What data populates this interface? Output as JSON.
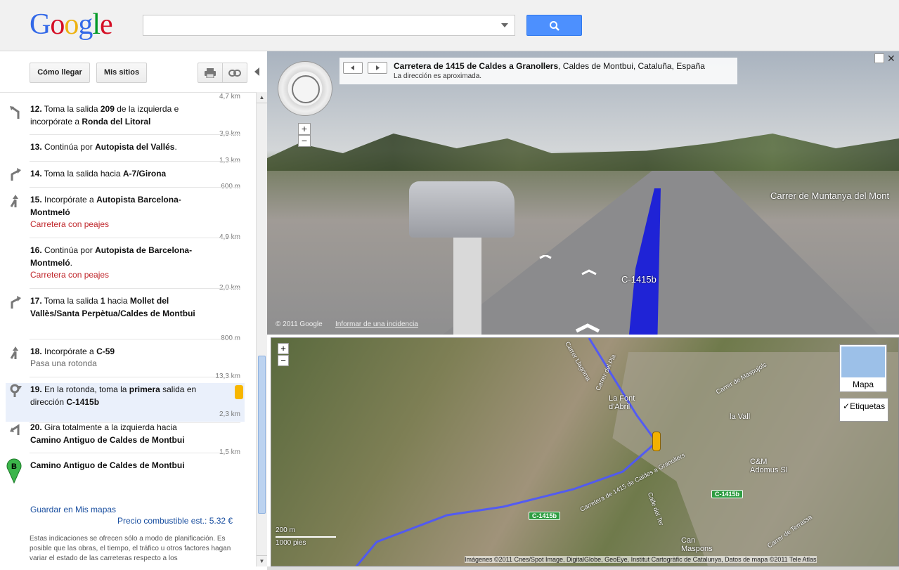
{
  "logo": {
    "text": "Google"
  },
  "search": {
    "value": "",
    "placeholder": ""
  },
  "colors": {
    "accent": "#4d90fe",
    "toll": "#c0282d",
    "link": "#1a4fa0",
    "route": "#1f23d6"
  },
  "toolbar": {
    "directions_label": "Cómo llegar",
    "mysites_label": "Mis sitios"
  },
  "distances": [
    "4,7 km",
    "3,9 km",
    "1,3 km",
    "600 m",
    "4,9 km",
    "2,0 km",
    "800 m",
    "13,3 km",
    "2,3 km",
    "1,5 km"
  ],
  "steps": [
    {
      "num": "12.",
      "pre": " Toma la salida ",
      "b1": "209",
      "mid": " de la izquierda e incorpórate a ",
      "b2": "Ronda del Litoral"
    },
    {
      "num": "13.",
      "pre": " Continúa por ",
      "b1": "Autopista del Vallés",
      "mid": ".",
      "b2": ""
    },
    {
      "num": "14.",
      "pre": " Toma la salida hacia ",
      "b1": "A-7/Girona",
      "mid": "",
      "b2": ""
    },
    {
      "num": "15.",
      "pre": " Incorpórate a ",
      "b1": "Autopista Barcelona-Montmeló",
      "mid": "",
      "b2": "",
      "note": "Carretera con peajes"
    },
    {
      "num": "16.",
      "pre": " Continúa por ",
      "b1": "Autopista de Barcelona-Montmeló",
      "mid": ".",
      "b2": "",
      "note": "Carretera con peajes"
    },
    {
      "num": "17.",
      "pre": " Toma la salida ",
      "b1": "1",
      "mid": " hacia ",
      "b2": "Mollet del Vallès/Santa Perpètua/Caldes de Montbui"
    },
    {
      "num": "18.",
      "pre": " Incorpórate a ",
      "b1": "C-59",
      "mid": "",
      "b2": "",
      "sub": "Pasa una rotonda"
    },
    {
      "num": "19.",
      "pre": " En la rotonda, toma la ",
      "b1": "primera",
      "mid": " salida en dirección ",
      "b2": "C-1415b"
    },
    {
      "num": "20.",
      "pre": " Gira totalmente a la izquierda hacia ",
      "b1": "Camino Antiguo de Caldes de Montbui",
      "mid": "",
      "b2": ""
    }
  ],
  "destination": {
    "marker": "B",
    "label": "Camino Antiguo de Caldes de Montbui"
  },
  "save_link": "Guardar en Mis mapas",
  "fuel": "Precio combustible est.: 5.32 €",
  "disclaimer": "Estas indicaciones se ofrecen sólo a modo de planificación. Es posible que las obras, el tiempo, el tráfico u otros factores hagan variar el estado de las carreteras respecto a los",
  "streetview": {
    "title_bold": "Carretera de 1415 de Caldes a Granollers",
    "title_rest": ", Caldes de Montbui, Cataluña, España",
    "note": "La dirección es aproximada.",
    "copyright": "© 2011 Google",
    "report": "Informar de una incidencia",
    "road_label": "C-1415b",
    "street_label": "Carrer de Muntanya del Mont",
    "zoom_in": "+",
    "zoom_out": "−"
  },
  "map": {
    "zoom_in": "+",
    "zoom_out": "−",
    "type_label": "Mapa",
    "labels_toggle": "Etiquetas",
    "place_labels": [
      "La Font d'Abril",
      "la Vall",
      "C&M Adomus Sl",
      "Can Maspons",
      "Carretera de 1415 de Caldes a Granollers",
      "Carrer de Maspujols",
      "Carrer de Terrassa",
      "Carrer Llagrima",
      "Carrer del Pla",
      "Calle del Ter"
    ],
    "shields": [
      "C-1415b",
      "C-1415b"
    ],
    "scale_m": "200 m",
    "scale_ft": "1000 pies",
    "attribution": "Imágenes ©2011 Cnes/Spot Image, DigitalGlobe, GeoEye, Institut Cartogràfic de Catalunya, Datos de mapa ©2011 Tele Atlas"
  }
}
